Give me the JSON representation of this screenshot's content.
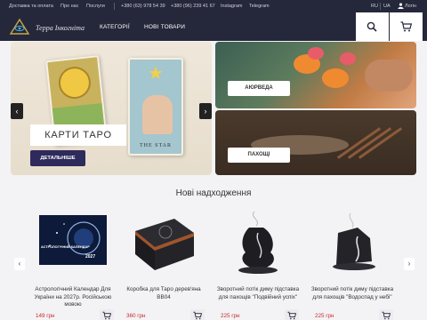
{
  "topbar": {
    "links": [
      "Доставка та оплата",
      "Про нас",
      "Послуги"
    ],
    "phones": [
      "+380 (63) 978 54 39",
      "+380 (96) 239 41 67"
    ],
    "socials": [
      "Instagram",
      "Telegram"
    ],
    "languages": [
      "RU",
      "UA"
    ],
    "login_label": "Логін"
  },
  "header": {
    "logo_text": "Терра Інкогніта",
    "nav": [
      "КАТЕГОРІЇ",
      "НОВІ ТОВАРИ"
    ],
    "icons": [
      "search-icon",
      "cart-icon"
    ]
  },
  "banners": {
    "main": {
      "title": "КАРТИ ТАРО",
      "button": "ДЕТАЛЬНІШЕ",
      "card_label": "THE STAR"
    },
    "side": [
      "АЮРВЕДА",
      "ПАХОЩІ"
    ]
  },
  "new_arrivals": {
    "title": "Нові надходження",
    "products": [
      {
        "name": "Астрологічний Календар Для України на 2027р. Російською мовою",
        "price": "149 грн",
        "image_text": "АСТРОЛОГІЧНИЙ КАЛЕНДАР",
        "image_year": "2027"
      },
      {
        "name": "Коробка для Таро дерев'яна BB04",
        "price": "360 грн"
      },
      {
        "name": "Зворотний потік диму підставка для пахощів \"Подвійний успіх\"",
        "price": "225 грн"
      },
      {
        "name": "Зворотний потік диму підставка для пахощів \"Водоспад у небі\"",
        "price": "225 грн"
      }
    ]
  },
  "colors": {
    "header_bg": "#25273a",
    "accent": "#2e2a5c",
    "price": "#c52b2b"
  }
}
